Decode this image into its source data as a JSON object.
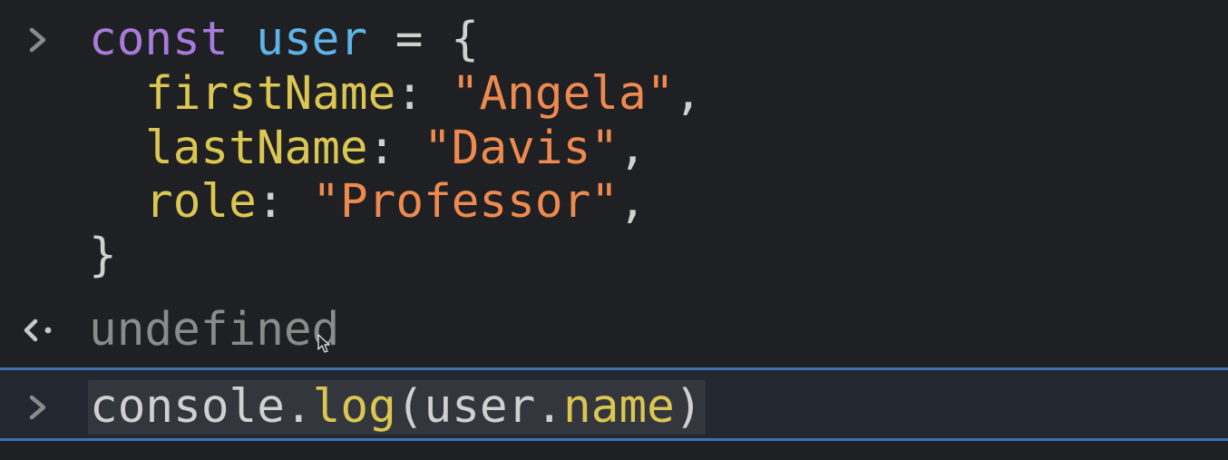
{
  "console": {
    "history": {
      "prompt_icon": "chevron-right-icon",
      "line1": {
        "kw": "const",
        "var": "user",
        "op": " = {"
      },
      "line2": {
        "key": "firstName",
        "sep": ": ",
        "val": "\"Angela\"",
        "end": ","
      },
      "line3": {
        "key": "lastName",
        "sep": ": ",
        "val": "\"Davis\"",
        "end": ","
      },
      "line4": {
        "key": "role",
        "sep": ": ",
        "val": "\"Professor\"",
        "end": ","
      },
      "line5": "}"
    },
    "result": {
      "icon": "return-arrow-icon",
      "value": "undefined"
    },
    "input": {
      "prompt_icon": "chevron-right-icon",
      "obj": "console",
      "dot1": ".",
      "method": "log",
      "paren_open": "(",
      "arg": "user",
      "dot2": ".",
      "prop": "name",
      "paren_close": ")"
    }
  },
  "colors": {
    "keyword": "#a77bd9",
    "variable": "#5fb3e6",
    "property": "#dcc652",
    "string": "#ee8a4f",
    "muted": "#8b8b8b",
    "focus_border": "#3f6fb0"
  }
}
